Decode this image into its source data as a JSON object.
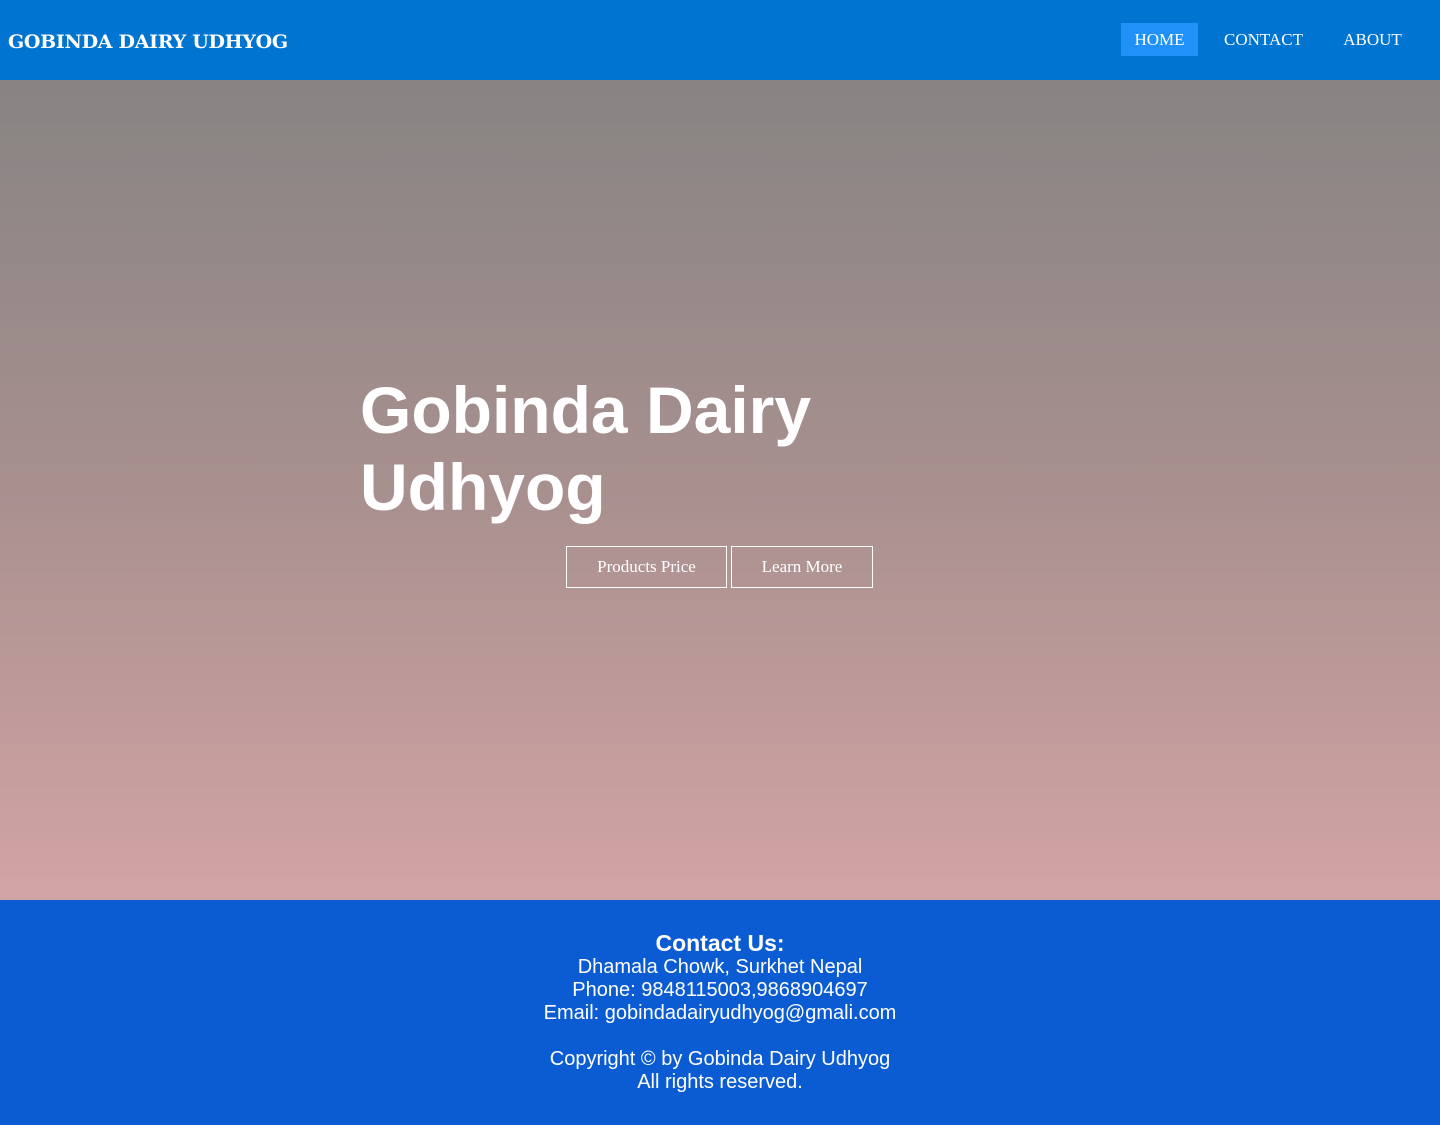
{
  "header": {
    "brand": "GOBINDA DAIRY UDHYOG",
    "nav": {
      "home": "HOME",
      "contact": "CONTACT",
      "about": "ABOUT"
    },
    "colors": {
      "bar": "#0074d1",
      "active_item": "#1f91f8"
    }
  },
  "hero": {
    "title": "Gobinda Dairy Udhyog",
    "buttons": {
      "products": "Products Price",
      "learn_more": "Learn More"
    }
  },
  "footer": {
    "heading": "Contact Us:",
    "address": "Dhamala Chowk, Surkhet Nepal",
    "phone": "Phone: 9848115003,9868904697",
    "email": "Email: gobindadairyudhyog@gmali.com",
    "copyright": "Copyright © by Gobinda Dairy Udhyog",
    "rights": "All rights reserved.",
    "colors": {
      "background": "#0b5bd3"
    }
  }
}
